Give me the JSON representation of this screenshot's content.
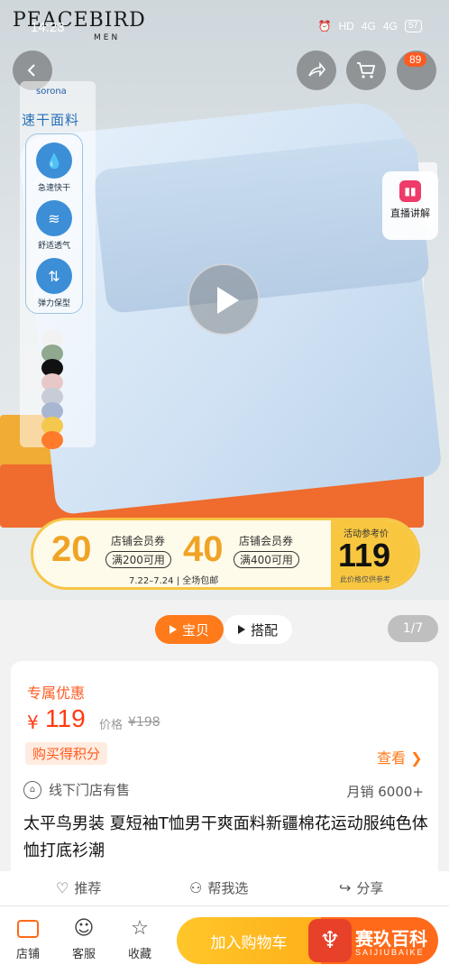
{
  "status_bar": {
    "time": "14:23",
    "hd": "HD",
    "signal1": "4G",
    "signal2": "4G",
    "battery": "57"
  },
  "brand": {
    "name": "PEACEBIRD",
    "sub": "MEN"
  },
  "header": {
    "message_badge": "89"
  },
  "fabric": {
    "brand": "sorona",
    "title": "速干面料",
    "features": [
      "急速快干",
      "舒适透气",
      "弹力保型"
    ]
  },
  "swatch_colors": [
    "#f2f2f2",
    "#8fa88e",
    "#111111",
    "#e8c8c6",
    "#c7ccd6",
    "#a9b6d2",
    "#f4c84c",
    "#ff7a2a"
  ],
  "live": {
    "label": "直播讲解"
  },
  "coupon": {
    "amount1": "20",
    "label1": "店铺会员券",
    "cond1": "满200可用",
    "amount2": "40",
    "label2": "店铺会员券",
    "cond2": "满400可用",
    "date": "7.22–7.24 | 全场包邮",
    "price_label": "活动参考价",
    "price": "119",
    "price_note": "此价格仅供参考"
  },
  "tabs": {
    "items": [
      "宝贝",
      "搭配"
    ],
    "active": 0,
    "page_indicator": "1/7"
  },
  "product": {
    "promo_title": "专属优惠",
    "currency": "¥",
    "price": "119",
    "orig_label": "价格",
    "orig_price": "¥198",
    "points_badge": "购买得积分",
    "view_link": "查看 ❯",
    "store_note": "线下门店有售",
    "sales": "月销 6000+",
    "title": "太平鸟男装 夏短袖T恤男干爽面料新疆棉花运动服纯色体恤打底衫潮"
  },
  "actions": [
    "推荐",
    "帮我选",
    "分享"
  ],
  "bottom_nav": [
    "店铺",
    "客服",
    "收藏"
  ],
  "add_cart_label": "加入购物车",
  "watermark": {
    "text": "赛玖百科",
    "sub": "SAIJIUBAIKE"
  }
}
